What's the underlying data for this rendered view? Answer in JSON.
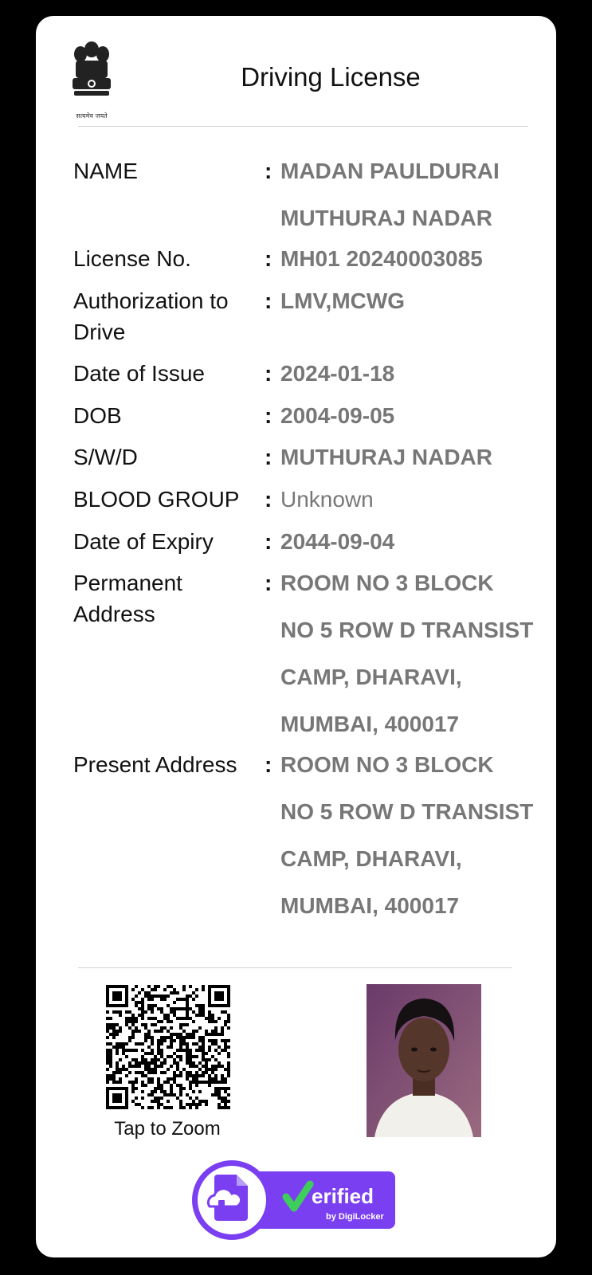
{
  "header": {
    "title": "Driving License",
    "emblem_caption": "सत्यमेव जयते"
  },
  "fields": [
    {
      "label": "NAME",
      "value_lines": [
        "MADAN PAULDURAI",
        "MUTHURAJ NADAR"
      ]
    },
    {
      "label": "License No.",
      "value_lines": [
        "MH01 20240003085"
      ]
    },
    {
      "label": "Authorization to Drive",
      "value_lines": [
        "LMV,MCWG"
      ]
    },
    {
      "label": "Date of Issue",
      "value_lines": [
        "2024-01-18"
      ]
    },
    {
      "label": "DOB",
      "value_lines": [
        "2004-09-05"
      ]
    },
    {
      "label": "S/W/D",
      "value_lines": [
        "MUTHURAJ NADAR"
      ]
    },
    {
      "label": "BLOOD GROUP",
      "value_lines": [
        "Unknown"
      ]
    },
    {
      "label": "Date of Expiry",
      "value_lines": [
        "2044-09-04"
      ]
    },
    {
      "label": "Permanent Address",
      "value_lines": [
        "ROOM NO 3 BLOCK",
        "NO 5 ROW D TRANSIST",
        "CAMP, DHARAVI,",
        "MUMBAI, 400017"
      ]
    },
    {
      "label": "Present Address",
      "value_lines": [
        "ROOM NO 3 BLOCK",
        "NO 5 ROW D TRANSIST",
        "CAMP, DHARAVI,",
        "MUMBAI, 400017"
      ]
    }
  ],
  "colon": ":",
  "qr": {
    "caption": "Tap to Zoom"
  },
  "badge": {
    "text": "erified",
    "subtext": "by DigiLocker",
    "check_color": "#3ecf5a",
    "brand_color": "#7b3ff2"
  },
  "icons": {
    "emblem": "national-emblem-icon",
    "qr": "qr-code-icon",
    "verified": "digilocker-verified-icon"
  }
}
